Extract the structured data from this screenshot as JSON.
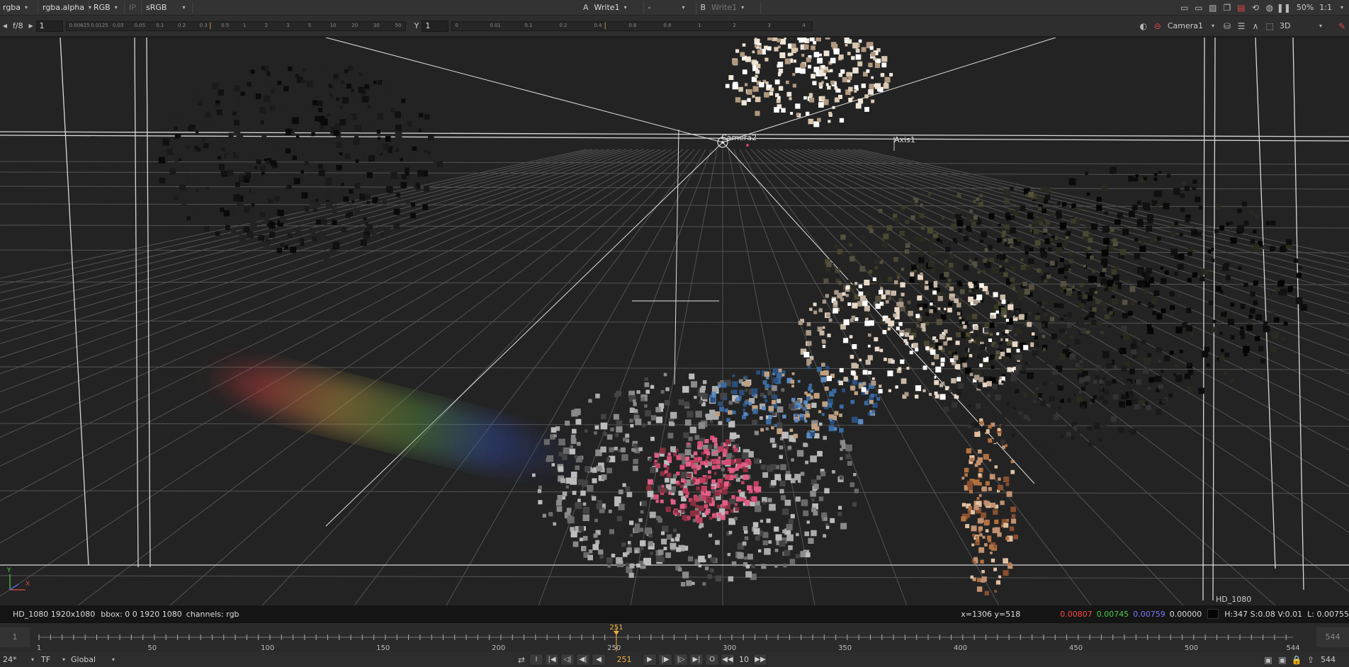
{
  "toolbar1": {
    "channels": "rgba",
    "alpha_channel": "rgba.alpha",
    "display_channels": "RGB",
    "ip_label": "IP",
    "colorspace": "sRGB",
    "a_label": "A",
    "a_input": "Write1",
    "compare_mode": "-",
    "b_label": "B",
    "b_input": "Write1",
    "zoom": "50%",
    "proxy_ratio": "1:1"
  },
  "toolbar2": {
    "fstop_label": "f/8",
    "gain_value": "1",
    "gain_ticks": [
      "0.00625",
      "0.0125",
      "0.03",
      "0.05",
      "0.1",
      "0.2",
      "0.3",
      "0.5",
      "1",
      "2",
      "3",
      "5",
      "10",
      "20",
      "30",
      "50"
    ],
    "gamma_label": "Y",
    "gamma_value": "1",
    "gamma_ticks": [
      "0",
      "0.01",
      "0.1",
      "0.2",
      "0.4",
      "0.6",
      "0.8",
      "1",
      "2",
      "3",
      "4"
    ],
    "camera": "Camera1",
    "view_mode": "3D"
  },
  "viewport": {
    "camera_label": "Camera2",
    "axis_label": "Axis1",
    "format_label": "HD_1080",
    "axis_gizmo": {
      "y": "Y",
      "x": "X"
    }
  },
  "status": {
    "format": "HD_1080 1920x1080",
    "bbox": "bbox: 0 0 1920 1080",
    "channels": "channels: rgb",
    "coords": "x=1306 y=518",
    "r": "0.00807",
    "g": "0.00745",
    "b": "0.00759",
    "a": "0.00000",
    "hsvl": "H:347 S:0.08 V:0.01  L: 0.00755",
    "colors": {
      "r": "#ff4a4a",
      "g": "#4ad04a",
      "b": "#6a6aff"
    }
  },
  "timeline": {
    "in_frame": "1",
    "out_frame": "544",
    "current_frame": "251",
    "tick_labels": [
      "1",
      "50",
      "100",
      "150",
      "200",
      "250",
      "300",
      "350",
      "400",
      "450",
      "500",
      "544"
    ],
    "start": 1,
    "end": 544,
    "current": 251
  },
  "transport": {
    "fps": "24*",
    "tf": "TF",
    "scope": "Global",
    "frame": "251",
    "increment": "10",
    "end_frame": "544"
  }
}
